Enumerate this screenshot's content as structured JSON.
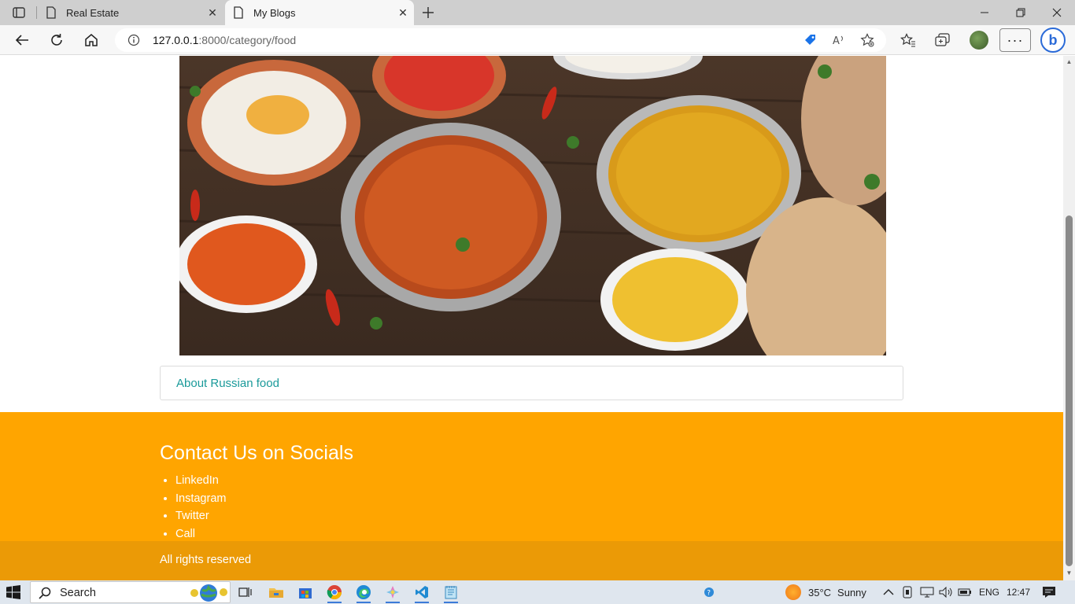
{
  "browser": {
    "tabs": [
      {
        "title": "Real Estate",
        "active": false
      },
      {
        "title": "My Blogs",
        "active": true
      }
    ],
    "address": {
      "host": "127.0.0.1",
      "path": ":8000/category/food"
    }
  },
  "page": {
    "hero_image_alt": "Indian food dishes",
    "card_link_text": "About Russian food",
    "footer": {
      "heading": "Contact Us on Socials",
      "links": [
        "LinkedIn",
        "Instagram",
        "Twitter",
        "Call"
      ],
      "copyright": "All rights reserved"
    }
  },
  "taskbar": {
    "search_label": "Search",
    "weather": {
      "temp": "35°C",
      "condition": "Sunny"
    },
    "language": "ENG",
    "time": "12:47"
  },
  "colors": {
    "footer_bg": "#ffa500",
    "subfooter_bg": "#eb9a06",
    "link_teal": "#1a9a9a"
  }
}
